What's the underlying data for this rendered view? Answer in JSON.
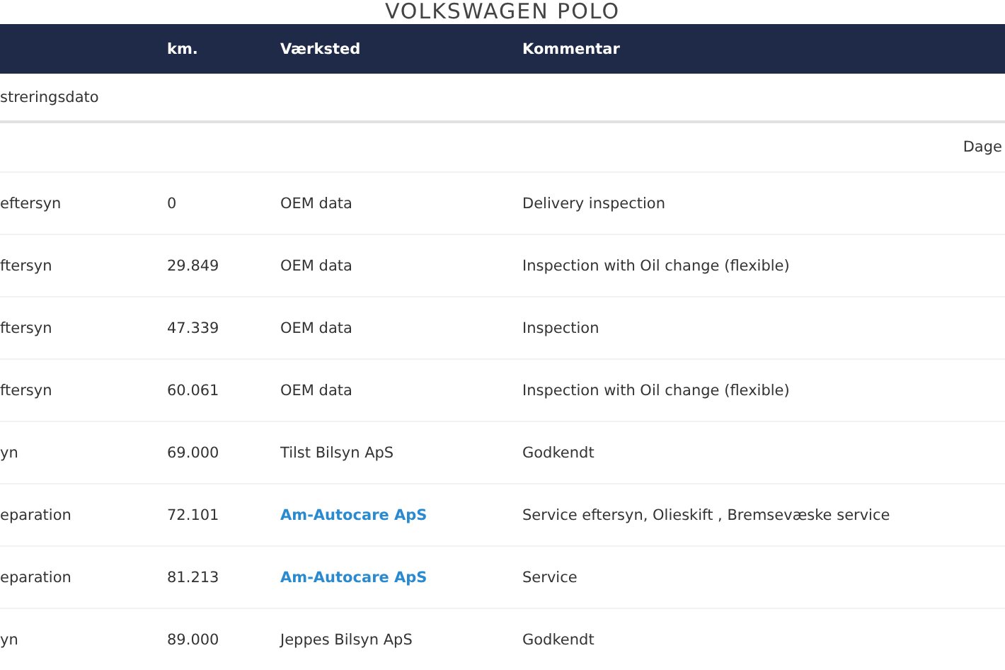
{
  "page_title": "VOLKSWAGEN POLO",
  "table": {
    "columns": [
      "",
      "km.",
      "Værksted",
      "Kommentar"
    ],
    "registration_row": "streringsdato",
    "days_label": "Dage",
    "rows": [
      {
        "type": "eftersyn",
        "km": "0",
        "workshop": "OEM data",
        "workshop_link": false,
        "comment": "Delivery inspection"
      },
      {
        "type": "ftersyn",
        "km": "29.849",
        "workshop": "OEM data",
        "workshop_link": false,
        "comment": "Inspection with Oil change (flexible)"
      },
      {
        "type": "ftersyn",
        "km": "47.339",
        "workshop": "OEM data",
        "workshop_link": false,
        "comment": "Inspection"
      },
      {
        "type": "ftersyn",
        "km": "60.061",
        "workshop": "OEM data",
        "workshop_link": false,
        "comment": "Inspection with Oil change (flexible)"
      },
      {
        "type": "yn",
        "km": "69.000",
        "workshop": "Tilst Bilsyn ApS",
        "workshop_link": false,
        "comment": "Godkendt"
      },
      {
        "type": "eparation",
        "km": "72.101",
        "workshop": "Am-Autocare ApS",
        "workshop_link": true,
        "comment": "Service eftersyn, Olieskift , Bremsevæske service"
      },
      {
        "type": "eparation",
        "km": "81.213",
        "workshop": "Am-Autocare ApS",
        "workshop_link": true,
        "comment": "Service"
      },
      {
        "type": "yn",
        "km": "89.000",
        "workshop": "Jeppes Bilsyn ApS",
        "workshop_link": false,
        "comment": "Godkendt"
      }
    ]
  }
}
